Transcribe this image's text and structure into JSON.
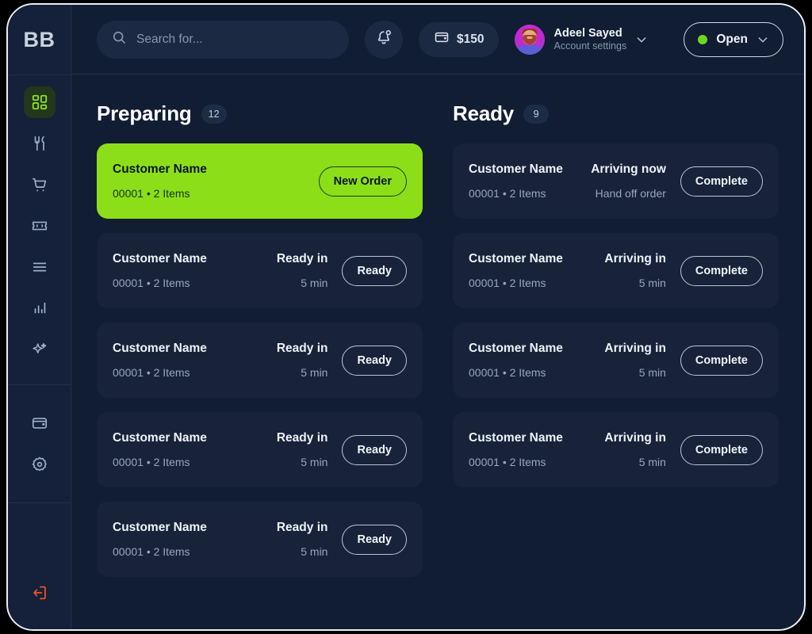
{
  "sidebar": {
    "logo": "BB",
    "primary_items": [
      {
        "icon": "dashboard-grid-icon",
        "name": "dashboard",
        "active": true
      },
      {
        "icon": "cutlery-icon",
        "name": "menu",
        "active": false
      },
      {
        "icon": "shopping-cart-icon",
        "name": "orders",
        "active": false
      },
      {
        "icon": "ticket-icon",
        "name": "coupons",
        "active": false
      },
      {
        "icon": "list-lines-icon",
        "name": "list",
        "active": false
      },
      {
        "icon": "bar-chart-icon",
        "name": "analytics",
        "active": false
      },
      {
        "icon": "sparkles-icon",
        "name": "ai-assistant",
        "active": false
      }
    ],
    "secondary_items": [
      {
        "icon": "wallet-icon",
        "name": "wallet",
        "active": false
      },
      {
        "icon": "gear-icon",
        "name": "settings",
        "active": false
      }
    ],
    "logout": {
      "icon": "logout-icon",
      "name": "logout",
      "color": "#f2541b"
    }
  },
  "header": {
    "search": {
      "value": "",
      "placeholder": "Search for..."
    },
    "notifications_icon": "bell-icon",
    "balance": {
      "icon": "wallet-icon",
      "amount": "$150"
    },
    "account": {
      "name": "Adeel Sayed",
      "subtitle": "Account settings",
      "chevron": "chevron-down-icon"
    },
    "status": {
      "label": "Open",
      "dot_color": "#6fd61f",
      "chevron": "chevron-down-icon"
    }
  },
  "board": {
    "columns": [
      {
        "title": "Preparing",
        "count": "12",
        "cards": [
          {
            "name": "Customer Name",
            "meta": "00001 • 2 Items",
            "mid_top": "",
            "mid_bottom": "",
            "action": "New Order",
            "highlight": true
          },
          {
            "name": "Customer Name",
            "meta": "00001 • 2 Items",
            "mid_top": "Ready in",
            "mid_bottom": "5 min",
            "action": "Ready",
            "highlight": false
          },
          {
            "name": "Customer Name",
            "meta": "00001 • 2 Items",
            "mid_top": "Ready in",
            "mid_bottom": "5 min",
            "action": "Ready",
            "highlight": false
          },
          {
            "name": "Customer Name",
            "meta": "00001 • 2 Items",
            "mid_top": "Ready in",
            "mid_bottom": "5 min",
            "action": "Ready",
            "highlight": false
          },
          {
            "name": "Customer Name",
            "meta": "00001 • 2 Items",
            "mid_top": "Ready in",
            "mid_bottom": "5 min",
            "action": "Ready",
            "highlight": false
          }
        ]
      },
      {
        "title": "Ready",
        "count": "9",
        "cards": [
          {
            "name": "Customer Name",
            "meta": "00001 • 2 Items",
            "mid_top": "Arriving now",
            "mid_bottom": "Hand off order",
            "action": "Complete",
            "highlight": false
          },
          {
            "name": "Customer Name",
            "meta": "00001 • 2 Items",
            "mid_top": "Arriving in",
            "mid_bottom": "5 min",
            "action": "Complete",
            "highlight": false
          },
          {
            "name": "Customer Name",
            "meta": "00001 • 2 Items",
            "mid_top": "Arriving in",
            "mid_bottom": "5 min",
            "action": "Complete",
            "highlight": false
          },
          {
            "name": "Customer Name",
            "meta": "00001 • 2 Items",
            "mid_top": "Arriving in",
            "mid_bottom": "5 min",
            "action": "Complete",
            "highlight": false
          }
        ]
      }
    ]
  },
  "colors": {
    "accent_green": "#8cdf18",
    "status_open": "#6fd61f",
    "logout_orange": "#f2541b",
    "card_bg": "#18233a",
    "page_bg": "#101d33"
  }
}
